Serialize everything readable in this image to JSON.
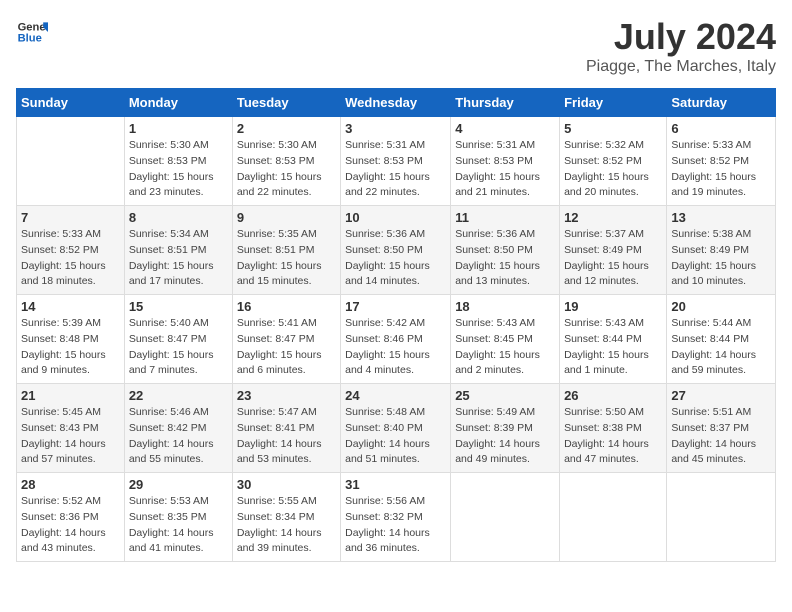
{
  "header": {
    "logo_general": "General",
    "logo_blue": "Blue",
    "month": "July 2024",
    "location": "Piagge, The Marches, Italy"
  },
  "days_of_week": [
    "Sunday",
    "Monday",
    "Tuesday",
    "Wednesday",
    "Thursday",
    "Friday",
    "Saturday"
  ],
  "weeks": [
    [
      {
        "day": "",
        "info": ""
      },
      {
        "day": "1",
        "info": "Sunrise: 5:30 AM\nSunset: 8:53 PM\nDaylight: 15 hours\nand 23 minutes."
      },
      {
        "day": "2",
        "info": "Sunrise: 5:30 AM\nSunset: 8:53 PM\nDaylight: 15 hours\nand 22 minutes."
      },
      {
        "day": "3",
        "info": "Sunrise: 5:31 AM\nSunset: 8:53 PM\nDaylight: 15 hours\nand 22 minutes."
      },
      {
        "day": "4",
        "info": "Sunrise: 5:31 AM\nSunset: 8:53 PM\nDaylight: 15 hours\nand 21 minutes."
      },
      {
        "day": "5",
        "info": "Sunrise: 5:32 AM\nSunset: 8:52 PM\nDaylight: 15 hours\nand 20 minutes."
      },
      {
        "day": "6",
        "info": "Sunrise: 5:33 AM\nSunset: 8:52 PM\nDaylight: 15 hours\nand 19 minutes."
      }
    ],
    [
      {
        "day": "7",
        "info": "Sunrise: 5:33 AM\nSunset: 8:52 PM\nDaylight: 15 hours\nand 18 minutes."
      },
      {
        "day": "8",
        "info": "Sunrise: 5:34 AM\nSunset: 8:51 PM\nDaylight: 15 hours\nand 17 minutes."
      },
      {
        "day": "9",
        "info": "Sunrise: 5:35 AM\nSunset: 8:51 PM\nDaylight: 15 hours\nand 15 minutes."
      },
      {
        "day": "10",
        "info": "Sunrise: 5:36 AM\nSunset: 8:50 PM\nDaylight: 15 hours\nand 14 minutes."
      },
      {
        "day": "11",
        "info": "Sunrise: 5:36 AM\nSunset: 8:50 PM\nDaylight: 15 hours\nand 13 minutes."
      },
      {
        "day": "12",
        "info": "Sunrise: 5:37 AM\nSunset: 8:49 PM\nDaylight: 15 hours\nand 12 minutes."
      },
      {
        "day": "13",
        "info": "Sunrise: 5:38 AM\nSunset: 8:49 PM\nDaylight: 15 hours\nand 10 minutes."
      }
    ],
    [
      {
        "day": "14",
        "info": "Sunrise: 5:39 AM\nSunset: 8:48 PM\nDaylight: 15 hours\nand 9 minutes."
      },
      {
        "day": "15",
        "info": "Sunrise: 5:40 AM\nSunset: 8:47 PM\nDaylight: 15 hours\nand 7 minutes."
      },
      {
        "day": "16",
        "info": "Sunrise: 5:41 AM\nSunset: 8:47 PM\nDaylight: 15 hours\nand 6 minutes."
      },
      {
        "day": "17",
        "info": "Sunrise: 5:42 AM\nSunset: 8:46 PM\nDaylight: 15 hours\nand 4 minutes."
      },
      {
        "day": "18",
        "info": "Sunrise: 5:43 AM\nSunset: 8:45 PM\nDaylight: 15 hours\nand 2 minutes."
      },
      {
        "day": "19",
        "info": "Sunrise: 5:43 AM\nSunset: 8:44 PM\nDaylight: 15 hours\nand 1 minute."
      },
      {
        "day": "20",
        "info": "Sunrise: 5:44 AM\nSunset: 8:44 PM\nDaylight: 14 hours\nand 59 minutes."
      }
    ],
    [
      {
        "day": "21",
        "info": "Sunrise: 5:45 AM\nSunset: 8:43 PM\nDaylight: 14 hours\nand 57 minutes."
      },
      {
        "day": "22",
        "info": "Sunrise: 5:46 AM\nSunset: 8:42 PM\nDaylight: 14 hours\nand 55 minutes."
      },
      {
        "day": "23",
        "info": "Sunrise: 5:47 AM\nSunset: 8:41 PM\nDaylight: 14 hours\nand 53 minutes."
      },
      {
        "day": "24",
        "info": "Sunrise: 5:48 AM\nSunset: 8:40 PM\nDaylight: 14 hours\nand 51 minutes."
      },
      {
        "day": "25",
        "info": "Sunrise: 5:49 AM\nSunset: 8:39 PM\nDaylight: 14 hours\nand 49 minutes."
      },
      {
        "day": "26",
        "info": "Sunrise: 5:50 AM\nSunset: 8:38 PM\nDaylight: 14 hours\nand 47 minutes."
      },
      {
        "day": "27",
        "info": "Sunrise: 5:51 AM\nSunset: 8:37 PM\nDaylight: 14 hours\nand 45 minutes."
      }
    ],
    [
      {
        "day": "28",
        "info": "Sunrise: 5:52 AM\nSunset: 8:36 PM\nDaylight: 14 hours\nand 43 minutes."
      },
      {
        "day": "29",
        "info": "Sunrise: 5:53 AM\nSunset: 8:35 PM\nDaylight: 14 hours\nand 41 minutes."
      },
      {
        "day": "30",
        "info": "Sunrise: 5:55 AM\nSunset: 8:34 PM\nDaylight: 14 hours\nand 39 minutes."
      },
      {
        "day": "31",
        "info": "Sunrise: 5:56 AM\nSunset: 8:32 PM\nDaylight: 14 hours\nand 36 minutes."
      },
      {
        "day": "",
        "info": ""
      },
      {
        "day": "",
        "info": ""
      },
      {
        "day": "",
        "info": ""
      }
    ]
  ]
}
